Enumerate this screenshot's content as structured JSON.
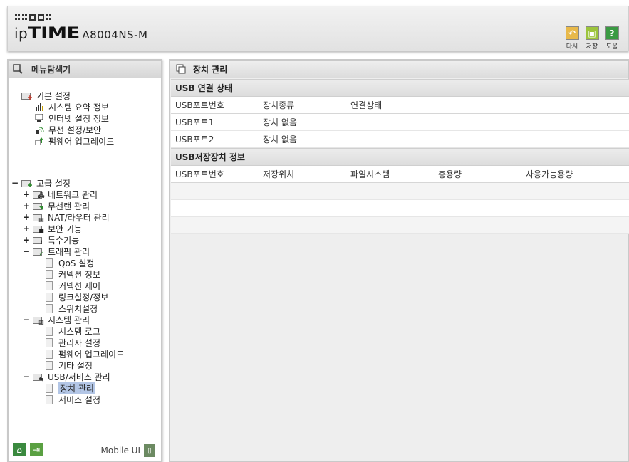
{
  "header": {
    "logo_ip": "ip",
    "logo_time": "TIME",
    "model": "A8004NS-M",
    "buttons": [
      {
        "label": "다시",
        "icon": "undo-icon",
        "glyph": "↶"
      },
      {
        "label": "저장",
        "icon": "save-icon",
        "glyph": "▣"
      },
      {
        "label": "도움",
        "icon": "help-icon",
        "glyph": "?"
      }
    ]
  },
  "sidebar": {
    "title": "메뉴탐색기",
    "basic": {
      "label": "기본 설정",
      "items": [
        {
          "label": "시스템 요약 정보",
          "icon": "chart-icon"
        },
        {
          "label": "인터넷 설정 정보",
          "icon": "monitor-icon"
        },
        {
          "label": "무선 설정/보안",
          "icon": "wireless-icon"
        },
        {
          "label": "펌웨어 업그레이드",
          "icon": "upgrade-icon"
        }
      ]
    },
    "advanced": {
      "label": "고급 설정",
      "toggle": "−",
      "groups": [
        {
          "label": "네트워크 관리",
          "toggle": "+",
          "icon": "network-icon"
        },
        {
          "label": "무선랜 관리",
          "toggle": "+",
          "icon": "wireless-icon"
        },
        {
          "label": "NAT/라우터 관리",
          "toggle": "+",
          "icon": "router-icon"
        },
        {
          "label": "보안 기능",
          "toggle": "+",
          "icon": "lock-icon"
        },
        {
          "label": "특수기능",
          "toggle": "+",
          "icon": "special-icon"
        },
        {
          "label": "트래픽 관리",
          "toggle": "−",
          "icon": "traffic-icon",
          "items": [
            "QoS 설정",
            "커넥션 정보",
            "커넥션 제어",
            "링크설정/정보",
            "스위치설정"
          ]
        },
        {
          "label": "시스템 관리",
          "toggle": "−",
          "icon": "system-icon",
          "items": [
            "시스템 로그",
            "관리자 설정",
            "펌웨어 업그레이드",
            "기타 설정"
          ]
        },
        {
          "label": "USB/서비스 관리",
          "toggle": "−",
          "icon": "usb-icon",
          "items": [
            "장치 관리",
            "서비스 설정"
          ]
        }
      ]
    },
    "footer": {
      "mobile_label": "Mobile UI"
    }
  },
  "main": {
    "title": "장치 관리",
    "usb_status": {
      "title": "USB 연결 상태",
      "columns": [
        "USB포트번호",
        "장치종류",
        "연결상태"
      ],
      "rows": [
        [
          "USB포트1",
          "장치 없음",
          ""
        ],
        [
          "USB포트2",
          "장치 없음",
          ""
        ]
      ]
    },
    "storage": {
      "title": "USB저장장치 정보",
      "columns": [
        "USB포트번호",
        "저장위치",
        "파일시스템",
        "총용량",
        "사용가능용량"
      ],
      "rows": [
        [
          "",
          "",
          "",
          "",
          ""
        ],
        [
          "",
          "",
          "",
          "",
          ""
        ],
        [
          "",
          "",
          "",
          "",
          ""
        ]
      ]
    }
  },
  "colors": {
    "selected_bg": "#b3c6e6",
    "undo_btn": "#e8b94a",
    "save_btn": "#9cc43c",
    "help_btn": "#3a9a42"
  }
}
